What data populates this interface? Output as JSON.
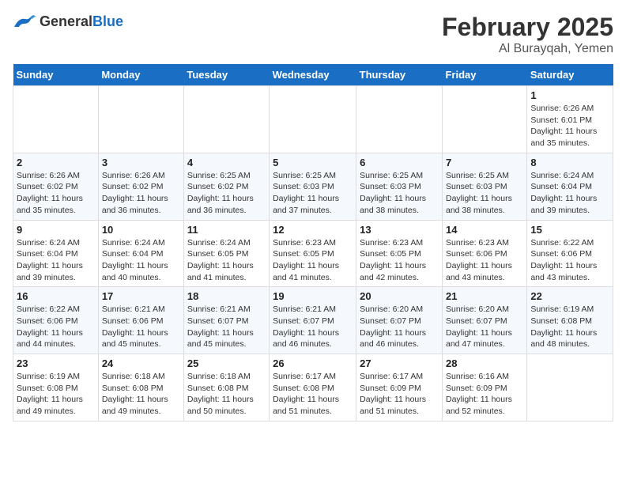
{
  "header": {
    "logo_general": "General",
    "logo_blue": "Blue",
    "title": "February 2025",
    "subtitle": "Al Burayqah, Yemen"
  },
  "weekdays": [
    "Sunday",
    "Monday",
    "Tuesday",
    "Wednesday",
    "Thursday",
    "Friday",
    "Saturday"
  ],
  "weeks": [
    [
      {
        "day": "",
        "sunrise": "",
        "sunset": "",
        "daylight": ""
      },
      {
        "day": "",
        "sunrise": "",
        "sunset": "",
        "daylight": ""
      },
      {
        "day": "",
        "sunrise": "",
        "sunset": "",
        "daylight": ""
      },
      {
        "day": "",
        "sunrise": "",
        "sunset": "",
        "daylight": ""
      },
      {
        "day": "",
        "sunrise": "",
        "sunset": "",
        "daylight": ""
      },
      {
        "day": "",
        "sunrise": "",
        "sunset": "",
        "daylight": ""
      },
      {
        "day": "1",
        "sunrise": "Sunrise: 6:26 AM",
        "sunset": "Sunset: 6:01 PM",
        "daylight": "Daylight: 11 hours and 35 minutes."
      }
    ],
    [
      {
        "day": "2",
        "sunrise": "Sunrise: 6:26 AM",
        "sunset": "Sunset: 6:02 PM",
        "daylight": "Daylight: 11 hours and 35 minutes."
      },
      {
        "day": "3",
        "sunrise": "Sunrise: 6:26 AM",
        "sunset": "Sunset: 6:02 PM",
        "daylight": "Daylight: 11 hours and 36 minutes."
      },
      {
        "day": "4",
        "sunrise": "Sunrise: 6:25 AM",
        "sunset": "Sunset: 6:02 PM",
        "daylight": "Daylight: 11 hours and 36 minutes."
      },
      {
        "day": "5",
        "sunrise": "Sunrise: 6:25 AM",
        "sunset": "Sunset: 6:03 PM",
        "daylight": "Daylight: 11 hours and 37 minutes."
      },
      {
        "day": "6",
        "sunrise": "Sunrise: 6:25 AM",
        "sunset": "Sunset: 6:03 PM",
        "daylight": "Daylight: 11 hours and 38 minutes."
      },
      {
        "day": "7",
        "sunrise": "Sunrise: 6:25 AM",
        "sunset": "Sunset: 6:03 PM",
        "daylight": "Daylight: 11 hours and 38 minutes."
      },
      {
        "day": "8",
        "sunrise": "Sunrise: 6:24 AM",
        "sunset": "Sunset: 6:04 PM",
        "daylight": "Daylight: 11 hours and 39 minutes."
      }
    ],
    [
      {
        "day": "9",
        "sunrise": "Sunrise: 6:24 AM",
        "sunset": "Sunset: 6:04 PM",
        "daylight": "Daylight: 11 hours and 39 minutes."
      },
      {
        "day": "10",
        "sunrise": "Sunrise: 6:24 AM",
        "sunset": "Sunset: 6:04 PM",
        "daylight": "Daylight: 11 hours and 40 minutes."
      },
      {
        "day": "11",
        "sunrise": "Sunrise: 6:24 AM",
        "sunset": "Sunset: 6:05 PM",
        "daylight": "Daylight: 11 hours and 41 minutes."
      },
      {
        "day": "12",
        "sunrise": "Sunrise: 6:23 AM",
        "sunset": "Sunset: 6:05 PM",
        "daylight": "Daylight: 11 hours and 41 minutes."
      },
      {
        "day": "13",
        "sunrise": "Sunrise: 6:23 AM",
        "sunset": "Sunset: 6:05 PM",
        "daylight": "Daylight: 11 hours and 42 minutes."
      },
      {
        "day": "14",
        "sunrise": "Sunrise: 6:23 AM",
        "sunset": "Sunset: 6:06 PM",
        "daylight": "Daylight: 11 hours and 43 minutes."
      },
      {
        "day": "15",
        "sunrise": "Sunrise: 6:22 AM",
        "sunset": "Sunset: 6:06 PM",
        "daylight": "Daylight: 11 hours and 43 minutes."
      }
    ],
    [
      {
        "day": "16",
        "sunrise": "Sunrise: 6:22 AM",
        "sunset": "Sunset: 6:06 PM",
        "daylight": "Daylight: 11 hours and 44 minutes."
      },
      {
        "day": "17",
        "sunrise": "Sunrise: 6:21 AM",
        "sunset": "Sunset: 6:06 PM",
        "daylight": "Daylight: 11 hours and 45 minutes."
      },
      {
        "day": "18",
        "sunrise": "Sunrise: 6:21 AM",
        "sunset": "Sunset: 6:07 PM",
        "daylight": "Daylight: 11 hours and 45 minutes."
      },
      {
        "day": "19",
        "sunrise": "Sunrise: 6:21 AM",
        "sunset": "Sunset: 6:07 PM",
        "daylight": "Daylight: 11 hours and 46 minutes."
      },
      {
        "day": "20",
        "sunrise": "Sunrise: 6:20 AM",
        "sunset": "Sunset: 6:07 PM",
        "daylight": "Daylight: 11 hours and 46 minutes."
      },
      {
        "day": "21",
        "sunrise": "Sunrise: 6:20 AM",
        "sunset": "Sunset: 6:07 PM",
        "daylight": "Daylight: 11 hours and 47 minutes."
      },
      {
        "day": "22",
        "sunrise": "Sunrise: 6:19 AM",
        "sunset": "Sunset: 6:08 PM",
        "daylight": "Daylight: 11 hours and 48 minutes."
      }
    ],
    [
      {
        "day": "23",
        "sunrise": "Sunrise: 6:19 AM",
        "sunset": "Sunset: 6:08 PM",
        "daylight": "Daylight: 11 hours and 49 minutes."
      },
      {
        "day": "24",
        "sunrise": "Sunrise: 6:18 AM",
        "sunset": "Sunset: 6:08 PM",
        "daylight": "Daylight: 11 hours and 49 minutes."
      },
      {
        "day": "25",
        "sunrise": "Sunrise: 6:18 AM",
        "sunset": "Sunset: 6:08 PM",
        "daylight": "Daylight: 11 hours and 50 minutes."
      },
      {
        "day": "26",
        "sunrise": "Sunrise: 6:17 AM",
        "sunset": "Sunset: 6:08 PM",
        "daylight": "Daylight: 11 hours and 51 minutes."
      },
      {
        "day": "27",
        "sunrise": "Sunrise: 6:17 AM",
        "sunset": "Sunset: 6:09 PM",
        "daylight": "Daylight: 11 hours and 51 minutes."
      },
      {
        "day": "28",
        "sunrise": "Sunrise: 6:16 AM",
        "sunset": "Sunset: 6:09 PM",
        "daylight": "Daylight: 11 hours and 52 minutes."
      },
      {
        "day": "",
        "sunrise": "",
        "sunset": "",
        "daylight": ""
      }
    ]
  ]
}
